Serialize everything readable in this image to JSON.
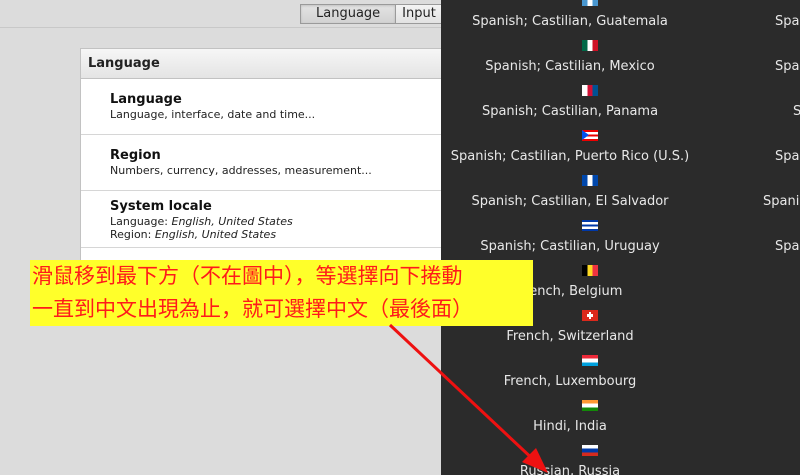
{
  "tabs": [
    {
      "label": "Language",
      "active": true
    },
    {
      "label": "Input",
      "active": false
    }
  ],
  "panel": {
    "header": "Language",
    "rows": [
      {
        "title": "Language",
        "desc": "Language, interface, date and time..."
      },
      {
        "title": "Region",
        "desc": "Numbers, currency, addresses, measurement..."
      },
      {
        "title": "System locale",
        "lines": [
          {
            "label": "Language: ",
            "value": "English, United States"
          },
          {
            "label": "Region: ",
            "value": "English, United States"
          }
        ]
      }
    ]
  },
  "languages": [
    {
      "label": "Spanish; Castilian, Guatemala",
      "flag": "guatemala-flag-icon",
      "colors": [
        "#4997d0",
        "#ffffff",
        "#4997d0"
      ]
    },
    {
      "label": "Spanish; Castilian, Mexico",
      "flag": "mexico-flag-icon",
      "colors": [
        "#006847",
        "#ffffff",
        "#ce1126"
      ]
    },
    {
      "label": "Spanish; Castilian, Panama",
      "flag": "panama-flag-icon",
      "colors": [
        "#ffffff",
        "#d21034",
        "#005293"
      ]
    },
    {
      "label": "Spanish; Castilian, Puerto Rico (U.S.)",
      "flag": "puerto-rico-flag-icon",
      "colors": [
        "#ed0000",
        "#ffffff",
        "#0050f0"
      ]
    },
    {
      "label": "Spanish; Castilian, El Salvador",
      "flag": "el-salvador-flag-icon",
      "colors": [
        "#0047ab",
        "#ffffff",
        "#0047ab"
      ]
    },
    {
      "label": "Spanish; Castilian, Uruguay",
      "flag": "uruguay-flag-icon",
      "colors": [
        "#0038a8",
        "#ffffff",
        "#0038a8"
      ]
    },
    {
      "label": "French, Belgium",
      "flag": "belgium-flag-icon",
      "colors": [
        "#000000",
        "#fdda24",
        "#ef3340"
      ]
    },
    {
      "label": "French, Switzerland",
      "flag": "switzerland-flag-icon",
      "colors": [
        "#da291c",
        "#ffffff",
        "#da291c"
      ]
    },
    {
      "label": "French, Luxembourg",
      "flag": "luxembourg-flag-icon",
      "colors": [
        "#ed2939",
        "#ffffff",
        "#00a1de"
      ]
    },
    {
      "label": "Hindi, India",
      "flag": "india-flag-icon",
      "colors": [
        "#ff9933",
        "#ffffff",
        "#138808"
      ]
    },
    {
      "label": "Russian, Russia",
      "flag": "russia-flag-icon",
      "colors": [
        "#ffffff",
        "#0039a6",
        "#d52b1e"
      ]
    }
  ],
  "second_column": [
    "Spa",
    "Spar",
    "S",
    "Spa",
    "Spani",
    "Spar"
  ],
  "annotation": {
    "line1": "滑鼠移到最下方（不在圖中），等選擇向下捲動",
    "line2": "一直到中文出現為止，就可選擇中文（最後面）",
    "text_color": "#ff1a1a",
    "highlight_color": "#ffff2a"
  }
}
